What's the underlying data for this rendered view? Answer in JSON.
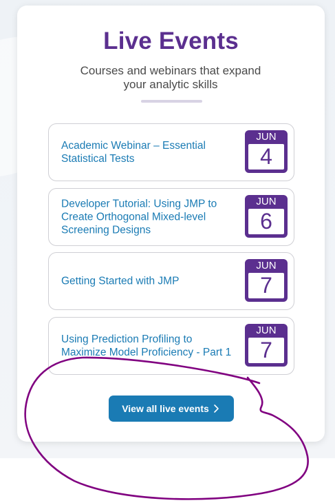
{
  "widget": {
    "title": "Live Events",
    "subtitle": "Courses and webinars that expand your analytic skills"
  },
  "events": [
    {
      "title": "Academic Webinar – Essential Statistical Tests",
      "month": "JUN",
      "day": "4"
    },
    {
      "title": "Developer Tutorial: Using JMP to Create Orthogonal Mixed-level Screening Designs",
      "month": "JUN",
      "day": "6"
    },
    {
      "title": "Getting Started with JMP",
      "month": "JUN",
      "day": "7"
    },
    {
      "title": "Using Prediction Profiling to Maximize Model Proficiency - Part 1",
      "month": "JUN",
      "day": "7"
    }
  ],
  "cta": {
    "label": "View all live events",
    "icon": "chevron-right-icon"
  },
  "colors": {
    "title_purple": "#5b2f8f",
    "link_blue": "#1a7bb4",
    "annotation_purple": "#800080"
  }
}
